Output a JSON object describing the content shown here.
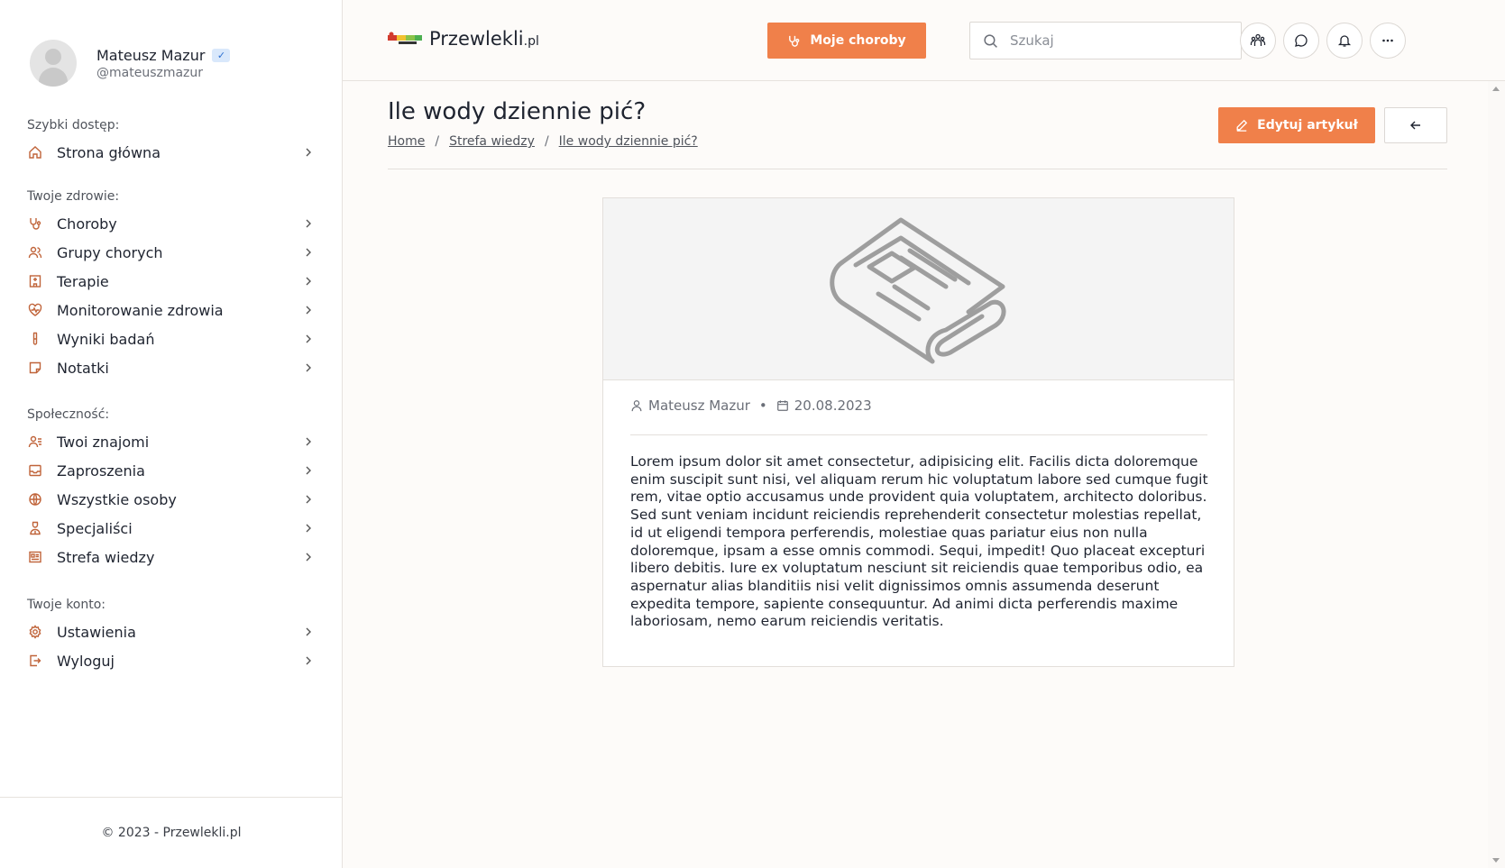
{
  "profile": {
    "name": "Mateusz Mazur",
    "handle": "@mateuszmazur",
    "verified_icon": "check-badge-icon"
  },
  "sidebar": {
    "sections": [
      {
        "title": "Szybki dostęp:",
        "items": [
          {
            "label": "Strona główna",
            "icon": "home-icon"
          }
        ]
      },
      {
        "title": "Twoje zdrowie:",
        "items": [
          {
            "label": "Choroby",
            "icon": "stethoscope-icon"
          },
          {
            "label": "Grupy chorych",
            "icon": "users-icon"
          },
          {
            "label": "Terapie",
            "icon": "hospital-icon"
          },
          {
            "label": "Monitorowanie zdrowia",
            "icon": "heart-pulse-icon"
          },
          {
            "label": "Wyniki badań",
            "icon": "test-tube-icon"
          },
          {
            "label": "Notatki",
            "icon": "note-icon"
          }
        ]
      },
      {
        "title": "Społeczność:",
        "items": [
          {
            "label": "Twoi znajomi",
            "icon": "user-list-icon"
          },
          {
            "label": "Zaproszenia",
            "icon": "inbox-icon"
          },
          {
            "label": "Wszystkie osoby",
            "icon": "globe-icon"
          },
          {
            "label": "Specjaliści",
            "icon": "doctor-icon"
          },
          {
            "label": "Strefa wiedzy",
            "icon": "newspaper-icon"
          }
        ]
      },
      {
        "title": "Twoje konto:",
        "items": [
          {
            "label": "Ustawienia",
            "icon": "gear-icon"
          },
          {
            "label": "Wyloguj",
            "icon": "logout-icon"
          }
        ]
      }
    ],
    "footer": "© 2023 - Przewlekli.pl"
  },
  "header": {
    "logo_text": "Przewlekli",
    "logo_suffix": ".pl",
    "diseases_button": "Moje choroby",
    "search_placeholder": "Szukaj"
  },
  "page": {
    "title": "Ile wody dziennie pić?",
    "breadcrumb": [
      "Home",
      "Strefa wiedzy",
      "Ile wody dziennie pić?"
    ],
    "edit_button": "Edytuj artykuł"
  },
  "article": {
    "author": "Mateusz Mazur",
    "date": "20.08.2023",
    "body": "Lorem ipsum dolor sit amet consectetur, adipisicing elit. Facilis dicta doloremque enim suscipit sunt nisi, vel aliquam rerum hic voluptatum labore sed cumque fugit rem, vitae optio accusamus unde provident quia voluptatem, architecto doloribus. Sed sunt veniam incidunt reiciendis reprehenderit consectetur molestias repellat, id ut eligendi tempora perferendis, molestiae quas pariatur eius non nulla doloremque, ipsam a esse omnis commodi. Sequi, impedit! Quo placeat excepturi libero debitis. Iure ex voluptatum nesciunt sit reiciendis quae temporibus odio, ea aspernatur alias blanditiis nisi velit dignissimos omnis assumenda deserunt expedita tempore, sapiente consequuntur. Ad animi dicta perferendis maxime laboriosam, nemo earum reiciendis veritatis."
  },
  "colors": {
    "accent": "#f0804a",
    "icon": "#c0643a"
  }
}
